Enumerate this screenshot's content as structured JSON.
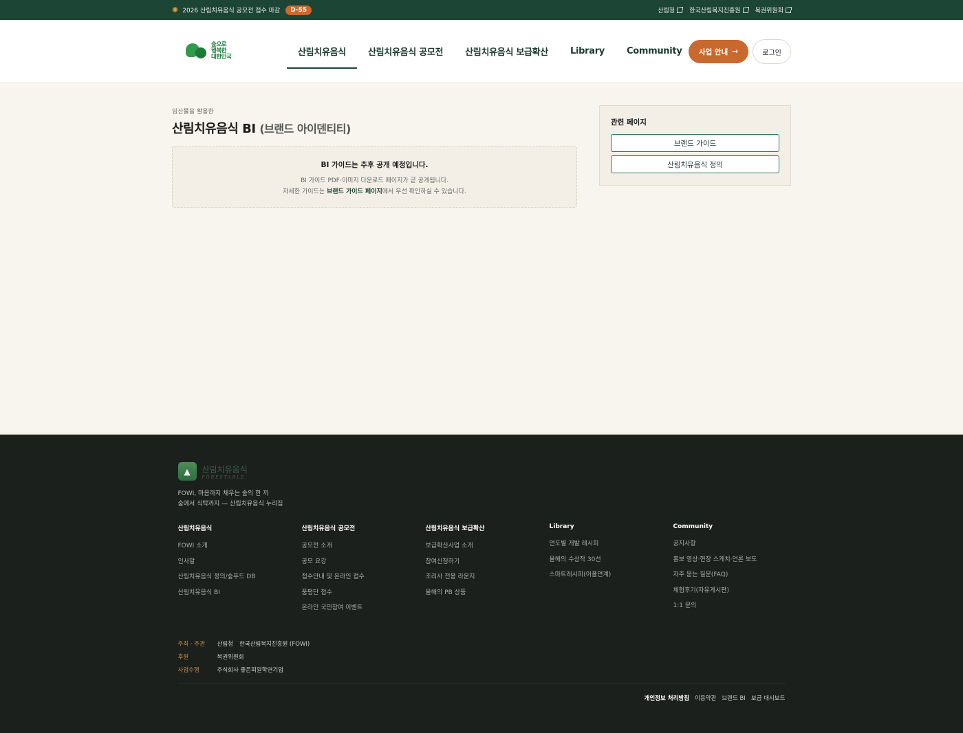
{
  "topbar": {
    "notice": "2026 산림치유음식 공모전 접수 마감",
    "dday": "D-55",
    "links": [
      "산림청",
      "한국산림복지진흥원",
      "복권위원회"
    ]
  },
  "header": {
    "logo_lines": [
      "숲으로",
      "행복한",
      "대한민국"
    ],
    "nav": [
      "산림치유음식",
      "산림치유음식 공모전",
      "산림치유음식 보급확산",
      "Library",
      "Community"
    ],
    "cta_label": "사업 안내",
    "cta_arrow": "→",
    "login_label": "로그인"
  },
  "main": {
    "eyebrow": "임산물을 활용한",
    "title": "산림치유음식 BI",
    "title_sub": "(브랜드 아이덴티티)",
    "notice": {
      "heading": "BI 가이드는 추후 공개 예정입니다.",
      "line1": "BI 가이드 PDF·이미지 다운로드 페이지가 곧 공개됩니다.",
      "line2_pre": "자세한 가이드는 ",
      "line2_strong": "브랜드 가이드 페이지",
      "line2_post": "에서 우선 확인하실 수 있습니다."
    },
    "related": {
      "heading": "관련 페이지",
      "buttons": [
        "브랜드 가이드",
        "산림치유음식 정의"
      ]
    }
  },
  "footer": {
    "brand": "산림치유음식",
    "brand_en": "FORESTABLE",
    "tagline": [
      "FOWI, 마음까지 채우는 숲의 한 끼",
      "숲에서 식탁까지 — 산림치유음식 누리집"
    ],
    "columns": [
      {
        "title": "산림치유음식",
        "items": [
          "FOWI 소개",
          "인사말",
          "산림치유음식 정의/숲푸드 DB",
          "산림치유음식 BI"
        ]
      },
      {
        "title": "산림치유음식 공모전",
        "items": [
          "공모전 소개",
          "공모 요강",
          "접수안내 및 온라인 접수",
          "품평단 접수",
          "온라인 국민참여 이벤트"
        ]
      },
      {
        "title": "산림치유음식 보급확산",
        "items": [
          "보급확산사업 소개",
          "참여신청하기",
          "조리사 전용 라운지",
          "올해의 PB 상품"
        ]
      },
      {
        "title": "Library",
        "items": [
          "연도별 개발 레시피",
          "올해의 수상작 30선",
          "스마트레시피(어플연계)"
        ]
      },
      {
        "title": "Community",
        "items": [
          "공지사항",
          "홍보 영상·현장 스케치·언론 보도",
          "자주 묻는 질문(FAQ)",
          "체험후기(자유게시판)",
          "1:1 문의"
        ]
      }
    ],
    "credits": [
      {
        "key": "주최 · 주관",
        "values": [
          "산림청",
          "한국산림복지진흥원 (FOWI)"
        ]
      },
      {
        "key": "후원",
        "values": [
          "복권위원회"
        ]
      },
      {
        "key": "사업수행",
        "values": [
          "주식회사 좋은피알학연기업"
        ]
      }
    ],
    "legal": [
      "개인정보 처리방침",
      "이용약관",
      "브랜드 BI",
      "보급 대시보드"
    ]
  },
  "colors": {
    "topbar_bg": "#1c4535",
    "accent": "#c9692e",
    "page_bg": "#f8f5ee",
    "footer_bg": "#1c201d",
    "brand_green": "#2b7a4f"
  }
}
